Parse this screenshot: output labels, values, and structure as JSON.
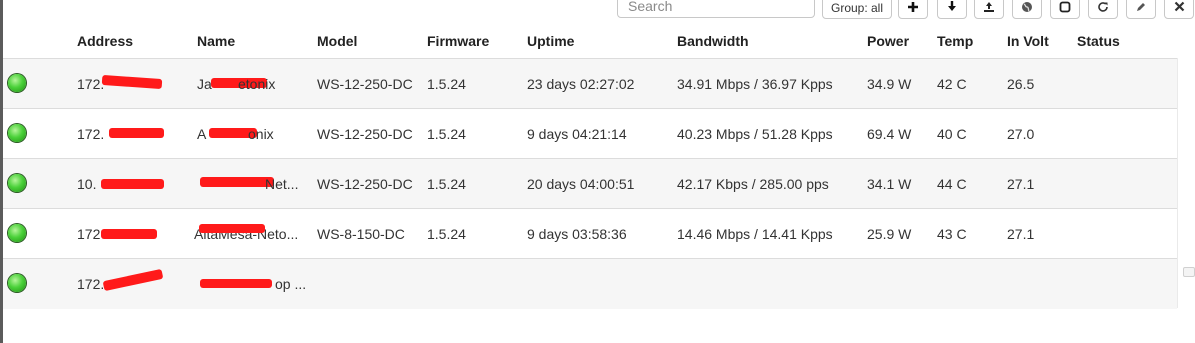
{
  "toolbar": {
    "search_placeholder": "Search",
    "group_label": "Group: all",
    "icons": [
      "plus-icon",
      "download-icon",
      "upload-icon",
      "globe-icon",
      "square-icon",
      "refresh-icon",
      "pencil-icon",
      "close-icon"
    ]
  },
  "table": {
    "headers": {
      "address": "Address",
      "name": "Name",
      "model": "Model",
      "firmware": "Firmware",
      "uptime": "Uptime",
      "bandwidth": "Bandwidth",
      "power": "Power",
      "temp": "Temp",
      "in_volt": "In Volt",
      "status": "Status"
    },
    "rows": [
      {
        "status_color": "#3cc22c",
        "address": "172.",
        "name": "Ja",
        "name_suffix": "etonix",
        "model": "WS-12-250-DC",
        "firmware": "1.5.24",
        "uptime": "23 days 02:27:02",
        "bandwidth": "34.91 Mbps / 36.97 Kpps",
        "power": "34.9 W",
        "temp": "42 C",
        "in_volt": "26.5"
      },
      {
        "status_color": "#3cc22c",
        "address": "172.",
        "name": "A",
        "name_suffix": "onix",
        "model": "WS-12-250-DC",
        "firmware": "1.5.24",
        "uptime": "9 days 04:21:14",
        "bandwidth": "40.23 Mbps / 51.28 Kpps",
        "power": "69.4 W",
        "temp": "40 C",
        "in_volt": "27.0"
      },
      {
        "status_color": "#3cc22c",
        "address": "10.",
        "name": "",
        "name_suffix": "Net...",
        "model": "WS-12-250-DC",
        "firmware": "1.5.24",
        "uptime": "20 days 04:00:51",
        "bandwidth": "42.17 Kbps / 285.00 pps",
        "power": "34.1 W",
        "temp": "44 C",
        "in_volt": "27.1"
      },
      {
        "status_color": "#3cc22c",
        "address": "172",
        "name": "AltaMesa-Neto...",
        "name_suffix": "",
        "model": "WS-8-150-DC",
        "firmware": "1.5.24",
        "uptime": "9 days 03:58:36",
        "bandwidth": "14.46 Mbps / 14.41 Kpps",
        "power": "25.9 W",
        "temp": "43 C",
        "in_volt": "27.1"
      },
      {
        "status_color": "#3cc22c",
        "address": "172.",
        "name": "",
        "name_suffix": "op ...",
        "model": "",
        "firmware": "",
        "uptime": "",
        "bandwidth": "",
        "power": "",
        "temp": "",
        "in_volt": ""
      }
    ]
  }
}
